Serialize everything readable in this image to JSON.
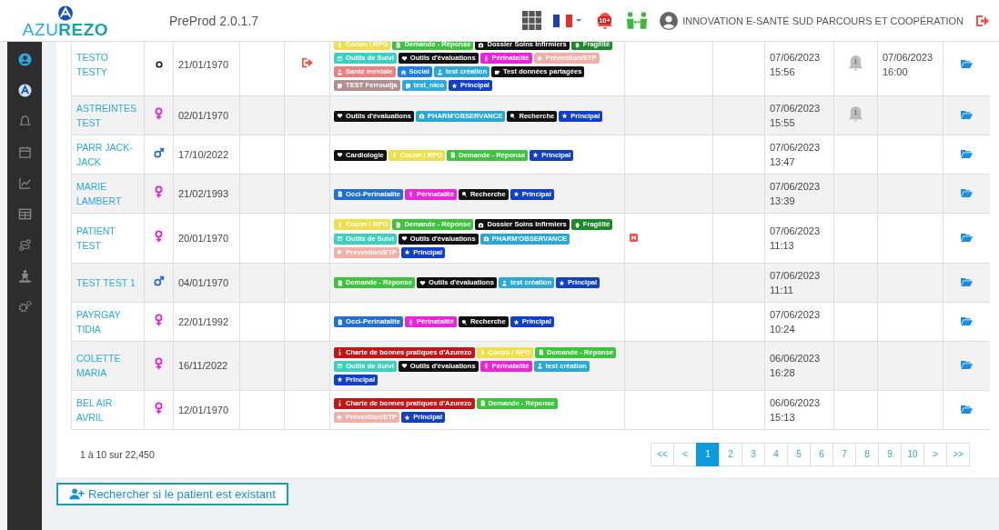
{
  "header": {
    "logo": "AZU**REZO**",
    "version": "PreProd 2.0.1.7",
    "notification_badge": "10+",
    "organization": "INNOVATION E-SANTÉ SUD PARCOURS ET COOPÉRATION"
  },
  "sidebar": {
    "items": [
      {
        "selected": true
      },
      {
        "selected": false
      },
      {
        "selected": false
      },
      {
        "selected": false
      },
      {
        "selected": false
      },
      {
        "selected": false
      },
      {
        "selected": false
      },
      {
        "selected": false
      },
      {
        "selected": false
      }
    ]
  },
  "rows": [
    {
      "name": "TESTO TESTY",
      "gender": {
        "kind": "unknown"
      },
      "birth_date": "21/01/1970",
      "exit": true,
      "hospital": false,
      "tags": [
        {
          "label": "Cocon / RPO",
          "color": "#ede04a",
          "kind": "baby"
        },
        {
          "label": "Demande - Réponse",
          "color": "#3cc43c",
          "kind": "doc"
        },
        {
          "label": "Dossier Soins Infirmiers",
          "color": "#111111",
          "kind": "medkit"
        },
        {
          "label": "Fragilité",
          "color": "#1a8a2a",
          "kind": "hand"
        },
        {
          "label": "Outils de Suivi",
          "color": "#3dd0c0",
          "kind": "table"
        },
        {
          "label": "Outils d'évaluations",
          "color": "#111111",
          "kind": "heart"
        },
        {
          "label": "Périnatalité",
          "color": "#ee22dd",
          "kind": "baby"
        },
        {
          "label": "Prévention/ETP",
          "color": "#f0b0a8",
          "kind": "chat"
        },
        {
          "label": "Santé mentale",
          "color": "#ee8080",
          "kind": "person"
        },
        {
          "label": "Social",
          "color": "#1a7ff0",
          "kind": "home"
        },
        {
          "label": "test création",
          "color": "#2aa8d8",
          "kind": "person"
        },
        {
          "label": "Test données partagées",
          "color": "#111111",
          "kind": "cup"
        },
        {
          "label": "TEST Ferroudja",
          "color": "#b09090",
          "kind": "note"
        },
        {
          "label": "test_nico",
          "color": "#30a8e0",
          "kind": "note"
        },
        {
          "label": "Principal",
          "color": "#1040c8",
          "kind": "star"
        }
      ],
      "created": "07/06/2023 15:56",
      "alerts": "1",
      "updated": "07/06/2023 16:00"
    },
    {
      "name": "ASTREINTES TEST",
      "gender": {
        "kind": "female"
      },
      "birth_date": "02/01/1970",
      "exit": false,
      "hospital": false,
      "tags": [
        {
          "label": "Outils d'évaluations",
          "color": "#111111",
          "kind": "heart"
        },
        {
          "label": "PHARM'OBSERVANCE",
          "color": "#28a8d8",
          "kind": "medkit"
        },
        {
          "label": "Recherche",
          "color": "#111111",
          "kind": "search"
        },
        {
          "label": "Principal",
          "color": "#1040c8",
          "kind": "star"
        }
      ],
      "created": "07/06/2023 15:55",
      "alerts": "1"
    },
    {
      "name": "PARR JACK-JACK",
      "gender": {
        "kind": "male"
      },
      "birth_date": "17/10/2022",
      "exit": false,
      "hospital": false,
      "tags": [
        {
          "label": "Cardiologie",
          "color": "#111111",
          "kind": "heart"
        },
        {
          "label": "Cocon / RPO",
          "color": "#ede04a",
          "kind": "baby"
        },
        {
          "label": "Demande - Réponse",
          "color": "#3cc43c",
          "kind": "doc"
        },
        {
          "label": "Principal",
          "color": "#1040c8",
          "kind": "star"
        }
      ],
      "created": "07/06/2023 13:47"
    },
    {
      "name": "MARIE LAMBERT",
      "gender": {
        "kind": "female"
      },
      "birth_date": "21/02/1993",
      "exit": false,
      "hospital": false,
      "tags": [
        {
          "label": "Occi-Perinatalite",
          "color": "#2070d0",
          "kind": "doc"
        },
        {
          "label": "Périnatalité",
          "color": "#ee22dd",
          "kind": "baby"
        },
        {
          "label": "Recherche",
          "color": "#111111",
          "kind": "search"
        },
        {
          "label": "Principal",
          "color": "#1040c8",
          "kind": "star"
        }
      ],
      "created": "07/06/2023 13:39"
    },
    {
      "name": "PATIENT TEST",
      "gender": {
        "kind": "female"
      },
      "birth_date": "20/01/1970",
      "exit": false,
      "hospital": true,
      "tags": [
        {
          "label": "Cocon / RPO",
          "color": "#ede04a",
          "kind": "baby"
        },
        {
          "label": "Demande - Réponse",
          "color": "#3cc43c",
          "kind": "doc"
        },
        {
          "label": "Dossier Soins Infirmiers",
          "color": "#111111",
          "kind": "medkit"
        },
        {
          "label": "Fragilité",
          "color": "#1a8a2a",
          "kind": "hand"
        },
        {
          "label": "Outils de Suivi",
          "color": "#3dd0c0",
          "kind": "table"
        },
        {
          "label": "Outils d'évaluations",
          "color": "#111111",
          "kind": "heart"
        },
        {
          "label": "PHARM'OBSERVANCE",
          "color": "#28a8d8",
          "kind": "medkit"
        },
        {
          "label": "Prévention/ETP",
          "color": "#f0b0a8",
          "kind": "chat"
        },
        {
          "label": "Principal",
          "color": "#1040c8",
          "kind": "star"
        }
      ],
      "created": "07/06/2023 11:13"
    },
    {
      "name": "TEST TEST 1",
      "gender": {
        "kind": "male"
      },
      "birth_date": "04/01/1970",
      "exit": false,
      "hospital": false,
      "tags": [
        {
          "label": "Demande - Réponse",
          "color": "#3cc43c",
          "kind": "doc"
        },
        {
          "label": "Outils d'évaluations",
          "color": "#111111",
          "kind": "heart"
        },
        {
          "label": "test création",
          "color": "#2aa8d8",
          "kind": "person"
        },
        {
          "label": "Principal",
          "color": "#1040c8",
          "kind": "star"
        }
      ],
      "created": "07/06/2023 11:11"
    },
    {
      "name": "PAYRGAY TIDIA",
      "gender": {
        "kind": "female"
      },
      "birth_date": "22/01/1992",
      "exit": false,
      "hospital": false,
      "tags": [
        {
          "label": "Occi-Perinatalite",
          "color": "#2070d0",
          "kind": "doc"
        },
        {
          "label": "Périnatalité",
          "color": "#ee22dd",
          "kind": "baby"
        },
        {
          "label": "Recherche",
          "color": "#111111",
          "kind": "search"
        },
        {
          "label": "Principal",
          "color": "#1040c8",
          "kind": "star"
        }
      ],
      "created": "07/06/2023 10:24"
    },
    {
      "name": "COLETTE MARIA",
      "gender": {
        "kind": "female"
      },
      "birth_date": "16/11/2022",
      "exit": false,
      "hospital": false,
      "tags": [
        {
          "label": "Charte de bonnes pratiques d'Azurezo",
          "color": "#c01818",
          "kind": "info"
        },
        {
          "label": "Cocon / RPO",
          "color": "#ede04a",
          "kind": "baby"
        },
        {
          "label": "Demande - Réponse",
          "color": "#3cc43c",
          "kind": "doc"
        },
        {
          "label": "Outils de Suivi",
          "color": "#3dd0c0",
          "kind": "table"
        },
        {
          "label": "Outils d'évaluations",
          "color": "#111111",
          "kind": "heart"
        },
        {
          "label": "Périnatalité",
          "color": "#ee22dd",
          "kind": "baby"
        },
        {
          "label": "test création",
          "color": "#2aa8d8",
          "kind": "person"
        },
        {
          "label": "Principal",
          "color": "#1040c8",
          "kind": "star"
        }
      ],
      "created": "06/06/2023 16:28"
    },
    {
      "name": "BEL AIR AVRIL",
      "gender": {
        "kind": "female"
      },
      "birth_date": "12/01/1970",
      "exit": false,
      "hospital": false,
      "tags": [
        {
          "label": "Charte de bonnes pratiques d'Azurezo",
          "color": "#c01818",
          "kind": "info"
        },
        {
          "label": "Demande - Réponse",
          "color": "#3cc43c",
          "kind": "doc"
        },
        {
          "label": "Prévention/ETP",
          "color": "#f0b0a8",
          "kind": "chat"
        },
        {
          "label": "Principal",
          "color": "#1040c8",
          "kind": "star"
        }
      ],
      "created": "06/06/2023 15:13"
    }
  ],
  "footer": {
    "count": "1 à 10 sur 22,450",
    "pages": [
      {
        "label": "<<",
        "selected": false
      },
      {
        "label": "<",
        "selected": false
      },
      {
        "label": "1",
        "selected": true
      },
      {
        "label": "2",
        "selected": false
      },
      {
        "label": "3",
        "selected": false
      },
      {
        "label": "4",
        "selected": false
      },
      {
        "label": "5",
        "selected": false
      },
      {
        "label": "6",
        "selected": false
      },
      {
        "label": "7",
        "selected": false
      },
      {
        "label": "8",
        "selected": false
      },
      {
        "label": "9",
        "selected": false
      },
      {
        "label": "10",
        "selected": false
      },
      {
        "label": ">",
        "selected": false
      },
      {
        "label": ">>",
        "selected": false
      }
    ]
  },
  "search_button": "Rechercher si le patient est existant"
}
